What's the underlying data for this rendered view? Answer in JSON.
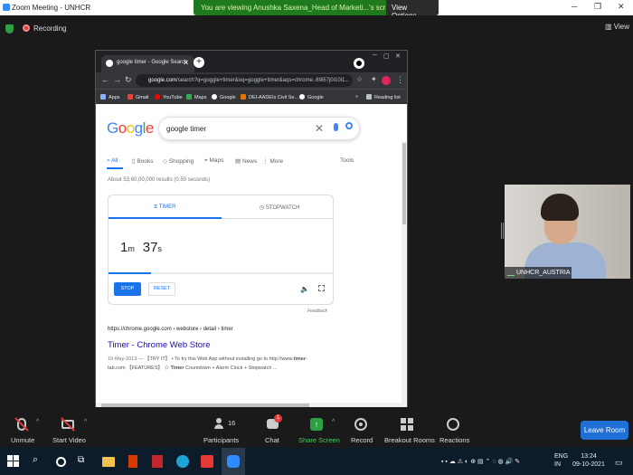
{
  "zoom": {
    "window_title": "Zoom Meeting - UNHCR",
    "banner_text": "You are viewing Anushka Saxena_Head of Marketi...'s screen",
    "view_options_label": "View Options",
    "recording_label": "Recording",
    "view_label": "View",
    "participant_name": "UNHCR_AUSTRIA",
    "participants_count": "16",
    "chat_badge": "1",
    "toolbar": {
      "unmute": "Unmute",
      "start_video": "Start Video",
      "participants": "Participants",
      "chat": "Chat",
      "share_screen": "Share Screen",
      "record": "Record",
      "breakout_rooms": "Breakout Rooms",
      "reactions": "Reactions",
      "leave": "Leave Room"
    },
    "colors": {
      "share_green": "#2ea043",
      "leave_blue": "#1f6fd6",
      "banner_green": "#1f7a1f"
    }
  },
  "browser": {
    "tab_title": "google timer - Google Search",
    "url_domain": "google.com",
    "url_rest": "/search?q=goggle+timer&oq=goggle+timer&aqs=chrome..69i57j0i10i1...",
    "bookmarks": [
      "Apps",
      "Gmail",
      "YouTube",
      "Maps",
      "Google",
      "DEI-AADEIs Civil Se...",
      "Google"
    ],
    "reading_list": "Reading list"
  },
  "google": {
    "logo_letters": [
      "G",
      "o",
      "o",
      "g",
      "l",
      "e"
    ],
    "logo_colors": [
      "#4285f4",
      "#ea4335",
      "#fbbc05",
      "#4285f4",
      "#34a853",
      "#ea4335"
    ],
    "query": "google timer",
    "tabs": [
      "All",
      "Books",
      "Shopping",
      "Maps",
      "News",
      "More"
    ],
    "tools": "Tools",
    "result_stats": "About 53,60,00,000 results (0.50 seconds)",
    "timer": {
      "tab_timer": "TIMER",
      "tab_stopwatch": "STOPWATCH",
      "minutes": "1",
      "min_unit": "m",
      "seconds": "37",
      "sec_unit": "s",
      "stop": "STOP",
      "reset": "RESET",
      "progress_fraction": 0.19
    },
    "feedback": "Feedback",
    "result": {
      "url": "https://chrome.google.com › webstore › detail › timer",
      "title": "Timer - Chrome Web Store",
      "date": "19-May-2013 —",
      "snippet_1": " 【TRY IT】 • To try this Web App without installing go to http://www.",
      "snippet_bold_1": "timer",
      "snippet_2": "-tab.com 【FEATURES】 ☆ ",
      "snippet_bold_2": "Timer",
      "snippet_3": " Countdown + Alarm Clock + Stopwatch ..."
    }
  },
  "taskbar": {
    "lang_1": "ENG",
    "lang_2": "IN",
    "time": "13:24",
    "date": "09-10-2021"
  }
}
